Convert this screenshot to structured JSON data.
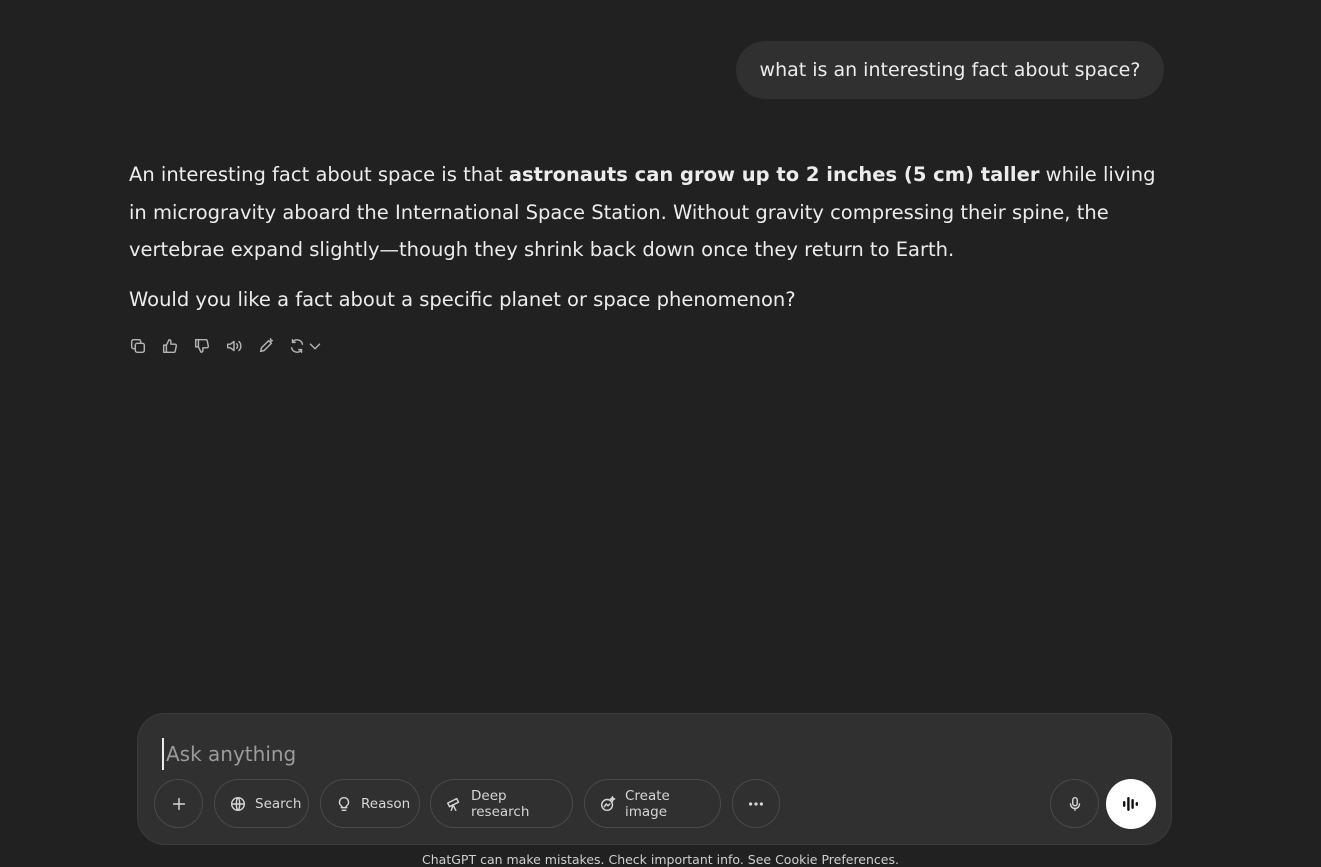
{
  "conversation": {
    "user_message": "what is an interesting fact about space?",
    "assistant": {
      "p1_before": "An interesting fact about space is that ",
      "p1_bold": "astronauts can grow up to 2 inches (5 cm) taller",
      "p1_after": " while living in microgravity aboard the International Space Station. Without gravity compressing their spine, the vertebrae expand slightly—though they shrink back down once they return to Earth.",
      "p2": "Would you like a fact about a specific planet or space phenomenon?"
    },
    "actions": [
      "copy-icon",
      "thumbs-up-icon",
      "thumbs-down-icon",
      "speaker-icon",
      "edit-icon",
      "regenerate-icon"
    ]
  },
  "composer": {
    "placeholder": "Ask anything",
    "search_label": "Search",
    "reason_label": "Reason",
    "deep_research_label": "Deep research",
    "create_image_label": "Create image"
  },
  "footer": {
    "text": "ChatGPT can make mistakes. Check important info. See Cookie Preferences."
  },
  "colors": {
    "background": "#212121",
    "bubble": "#303030",
    "composer": "#303030",
    "text": "#ececec",
    "voice_button": "#ffffff"
  }
}
